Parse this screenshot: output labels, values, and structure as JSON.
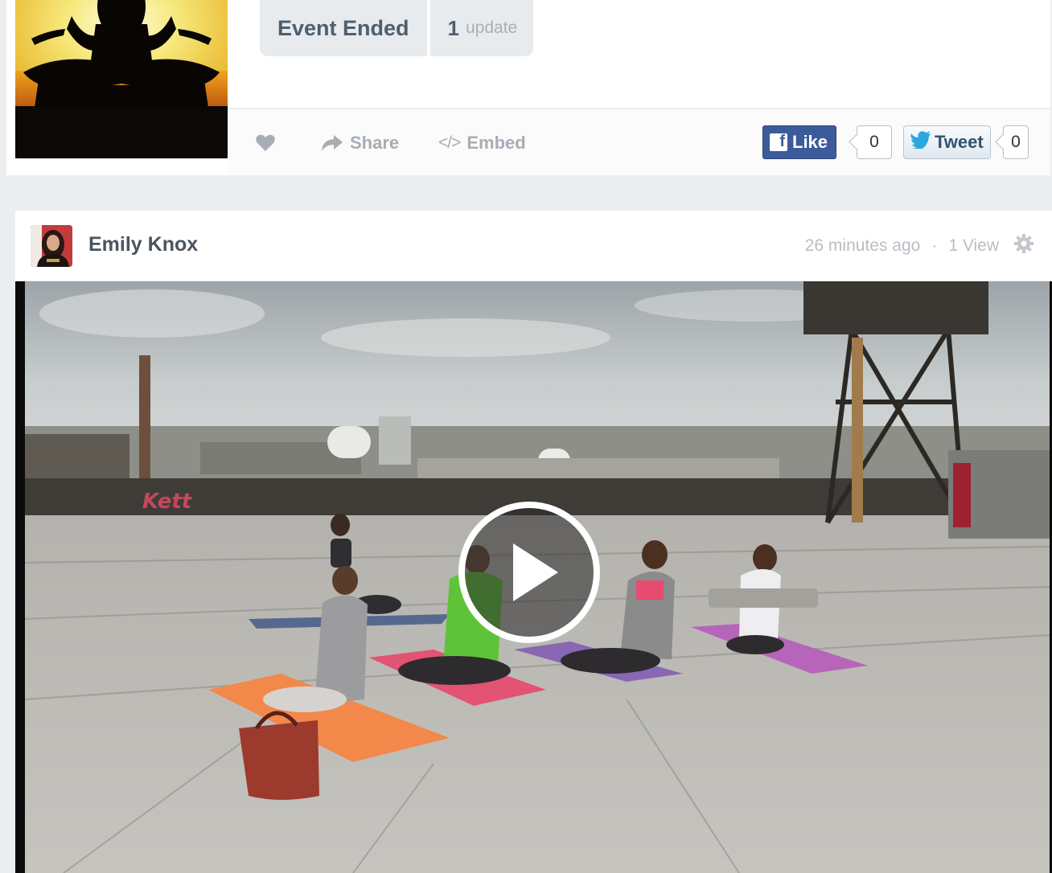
{
  "event": {
    "status_label": "Event Ended",
    "update_count": "1",
    "update_label": "update"
  },
  "actions": {
    "share_label": "Share",
    "embed_label": "Embed"
  },
  "social": {
    "fb_like_label": "Like",
    "fb_count": "0",
    "tweet_label": "Tweet",
    "tweet_count": "0"
  },
  "post": {
    "author": "Emily Knox",
    "time_ago": "26 minutes ago",
    "separator": "·",
    "views": "1 View"
  },
  "colors": {
    "facebook_blue": "#3b5b9a",
    "twitter_blue": "#2ca7e0",
    "status_pill_bg": "#e7ebee",
    "page_bg": "#ebeef1"
  },
  "icons": [
    "heart-icon",
    "share-arrow-icon",
    "embed-code-icon",
    "facebook-icon",
    "twitter-bird-icon",
    "gear-icon",
    "play-icon"
  ]
}
